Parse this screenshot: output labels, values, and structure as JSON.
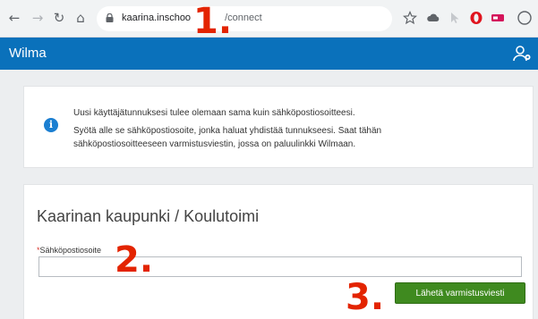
{
  "browser": {
    "url_host": "kaarina.inschoo",
    "url_path": "/connect",
    "colors": {
      "toolbar": "#f1f3f4"
    }
  },
  "app": {
    "brand": "Wilma",
    "header_color": "#0a71bb"
  },
  "notice": {
    "line1": "Uusi käyttäjätunnuksesi tulee olemaan sama kuin sähköpostiosoitteesi.",
    "line2": "Syötä alle se sähköpostiosoite, jonka haluat yhdistää tunnukseesi. Saat tähän sähköpostiosoitteeseen varmistusviestin, jossa on paluulinkki Wilmaan."
  },
  "form": {
    "title": "Kaarinan kaupunki / Koulutoimi",
    "required_mark": "*",
    "email_label": "Sähköpostiosoite",
    "email_value": "",
    "submit_label": "Lähetä varmistusviesti",
    "submit_color": "#3f8a1f"
  },
  "annotations": {
    "step1": "1.",
    "step2": "2.",
    "step3": "3.",
    "color": "#e32400"
  }
}
